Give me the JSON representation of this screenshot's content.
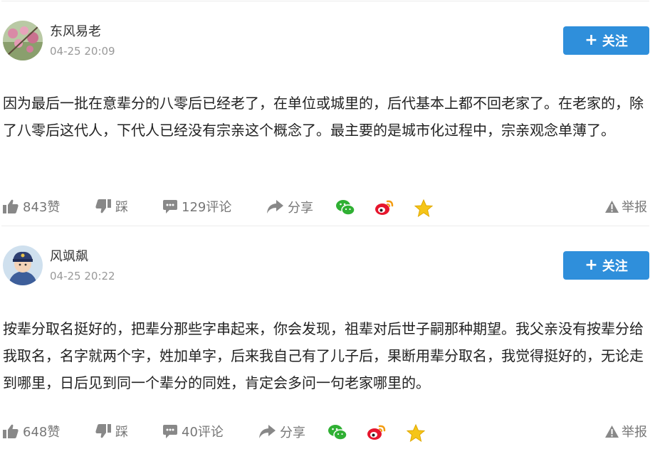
{
  "comments": [
    {
      "username": "东风易老",
      "time": "04-25 20:09",
      "follow_label": "关注",
      "content": "因为最后一批在意辈分的八零后已经老了，在单位或城里的，后代基本上都不回老家了。在老家的，除了八零后这代人，下代人已经没有宗亲这个概念了。最主要的是城市化过程中，宗亲观念单薄了。",
      "like_label": "843赞",
      "dislike_label": "踩",
      "comment_label": "129评论",
      "share_label": "分享",
      "report_label": "举报"
    },
    {
      "username": "风飒飙",
      "time": "04-25 20:22",
      "follow_label": "关注",
      "content": "按辈分取名挺好的，把辈分那些字串起来，你会发现，祖辈对后世子嗣那种期望。我父亲没有按辈分给我取名，名字就两个字，姓加单字，后来我自己有了儿子后，果断用辈分取名，我觉得挺好的，无论走到哪里，日后见到同一个辈分的同姓，肯定会多问一句老家哪里的。",
      "like_label": "648赞",
      "dislike_label": "踩",
      "comment_label": "40评论",
      "share_label": "分享",
      "report_label": "举报"
    }
  ],
  "colors": {
    "follow_button": "#2f8fdb",
    "wechat": "#2fb033",
    "weibo": "#e6162d",
    "favorite": "#f5c518",
    "action_gray": "#888888"
  },
  "icons": [
    "avatar",
    "plus-icon",
    "thumb-up-icon",
    "thumb-down-icon",
    "comment-icon",
    "share-arrow-icon",
    "wechat-icon",
    "weibo-icon",
    "star-icon",
    "warning-icon"
  ]
}
